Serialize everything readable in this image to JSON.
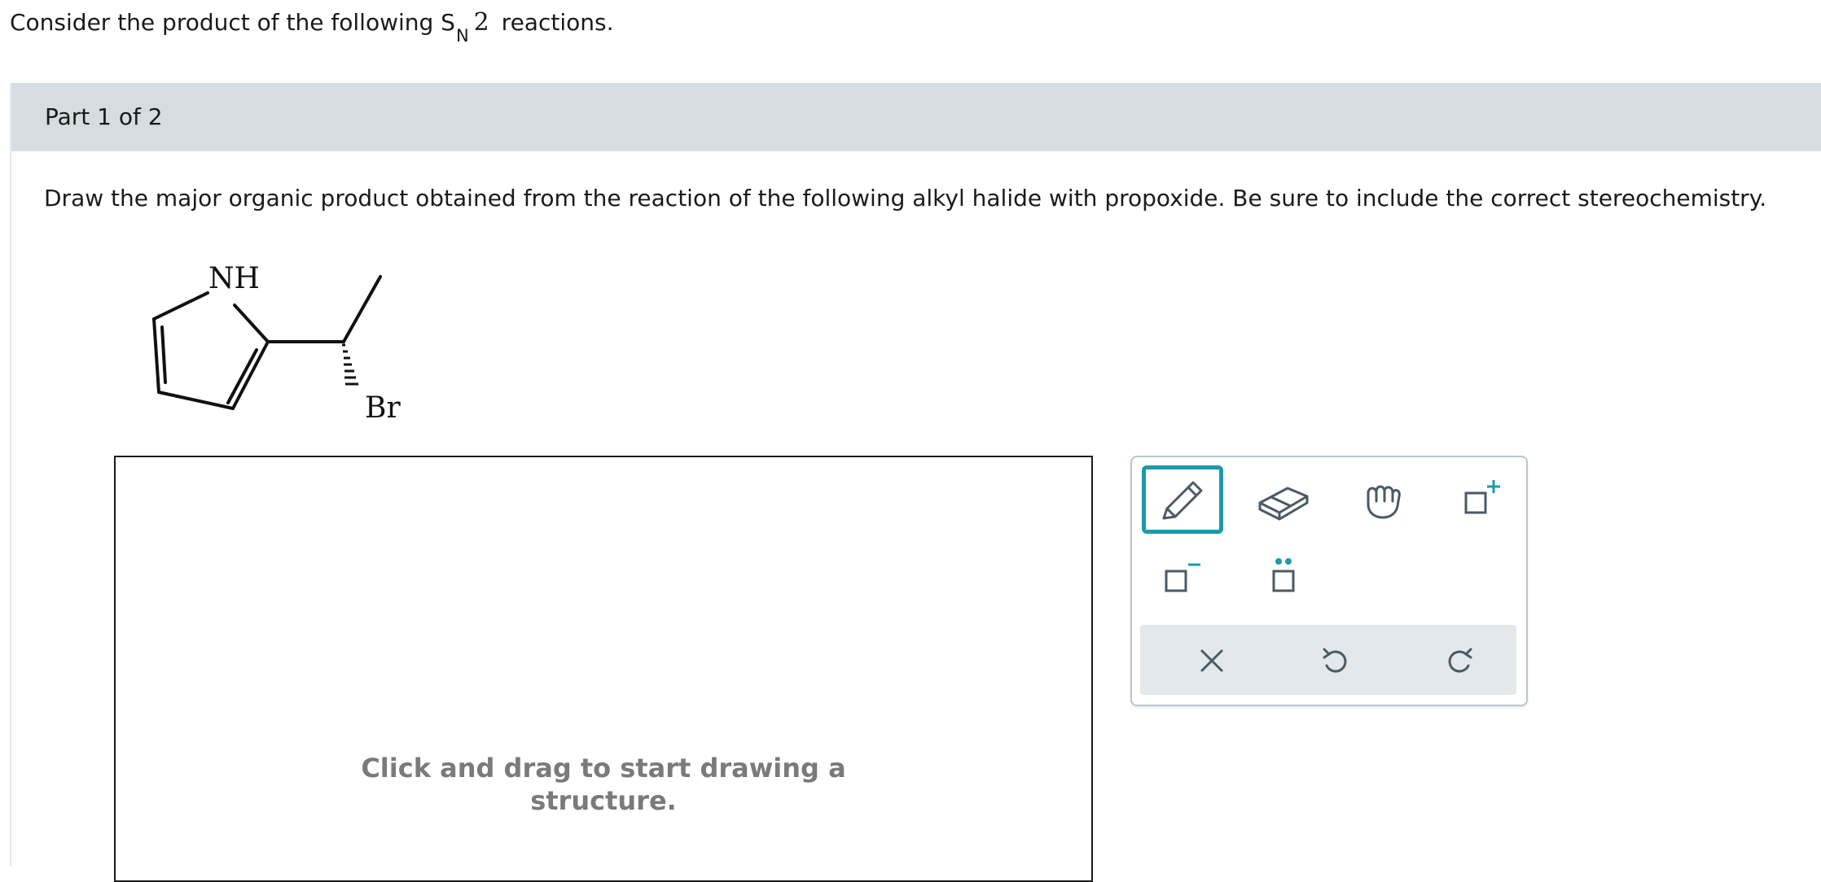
{
  "intro": {
    "prefix": "Consider the product of the following ",
    "sn_s": "S",
    "sn_n": "N",
    "sn_2": "2",
    "suffix": " reactions."
  },
  "part": {
    "title": "Part 1 of 2"
  },
  "question": {
    "text": "Draw the major organic product obtained from the reaction of the following alkyl halide with propoxide. Be sure to include the correct stereochemistry."
  },
  "molecule": {
    "nh_label": "NH",
    "br_label": "Br"
  },
  "canvas": {
    "hint_line1": "Click and drag to start drawing a",
    "hint_line2": "structure."
  },
  "toolbar": {
    "accent": "#1b9aaa",
    "tools": [
      {
        "name": "pencil-icon"
      },
      {
        "name": "eraser-icon"
      },
      {
        "name": "hand-icon"
      },
      {
        "name": "positive-charge-icon"
      },
      {
        "name": "negative-charge-icon"
      },
      {
        "name": "lone-pair-icon"
      },
      {
        "name": "clear-icon"
      },
      {
        "name": "undo-icon"
      },
      {
        "name": "redo-icon"
      }
    ]
  }
}
